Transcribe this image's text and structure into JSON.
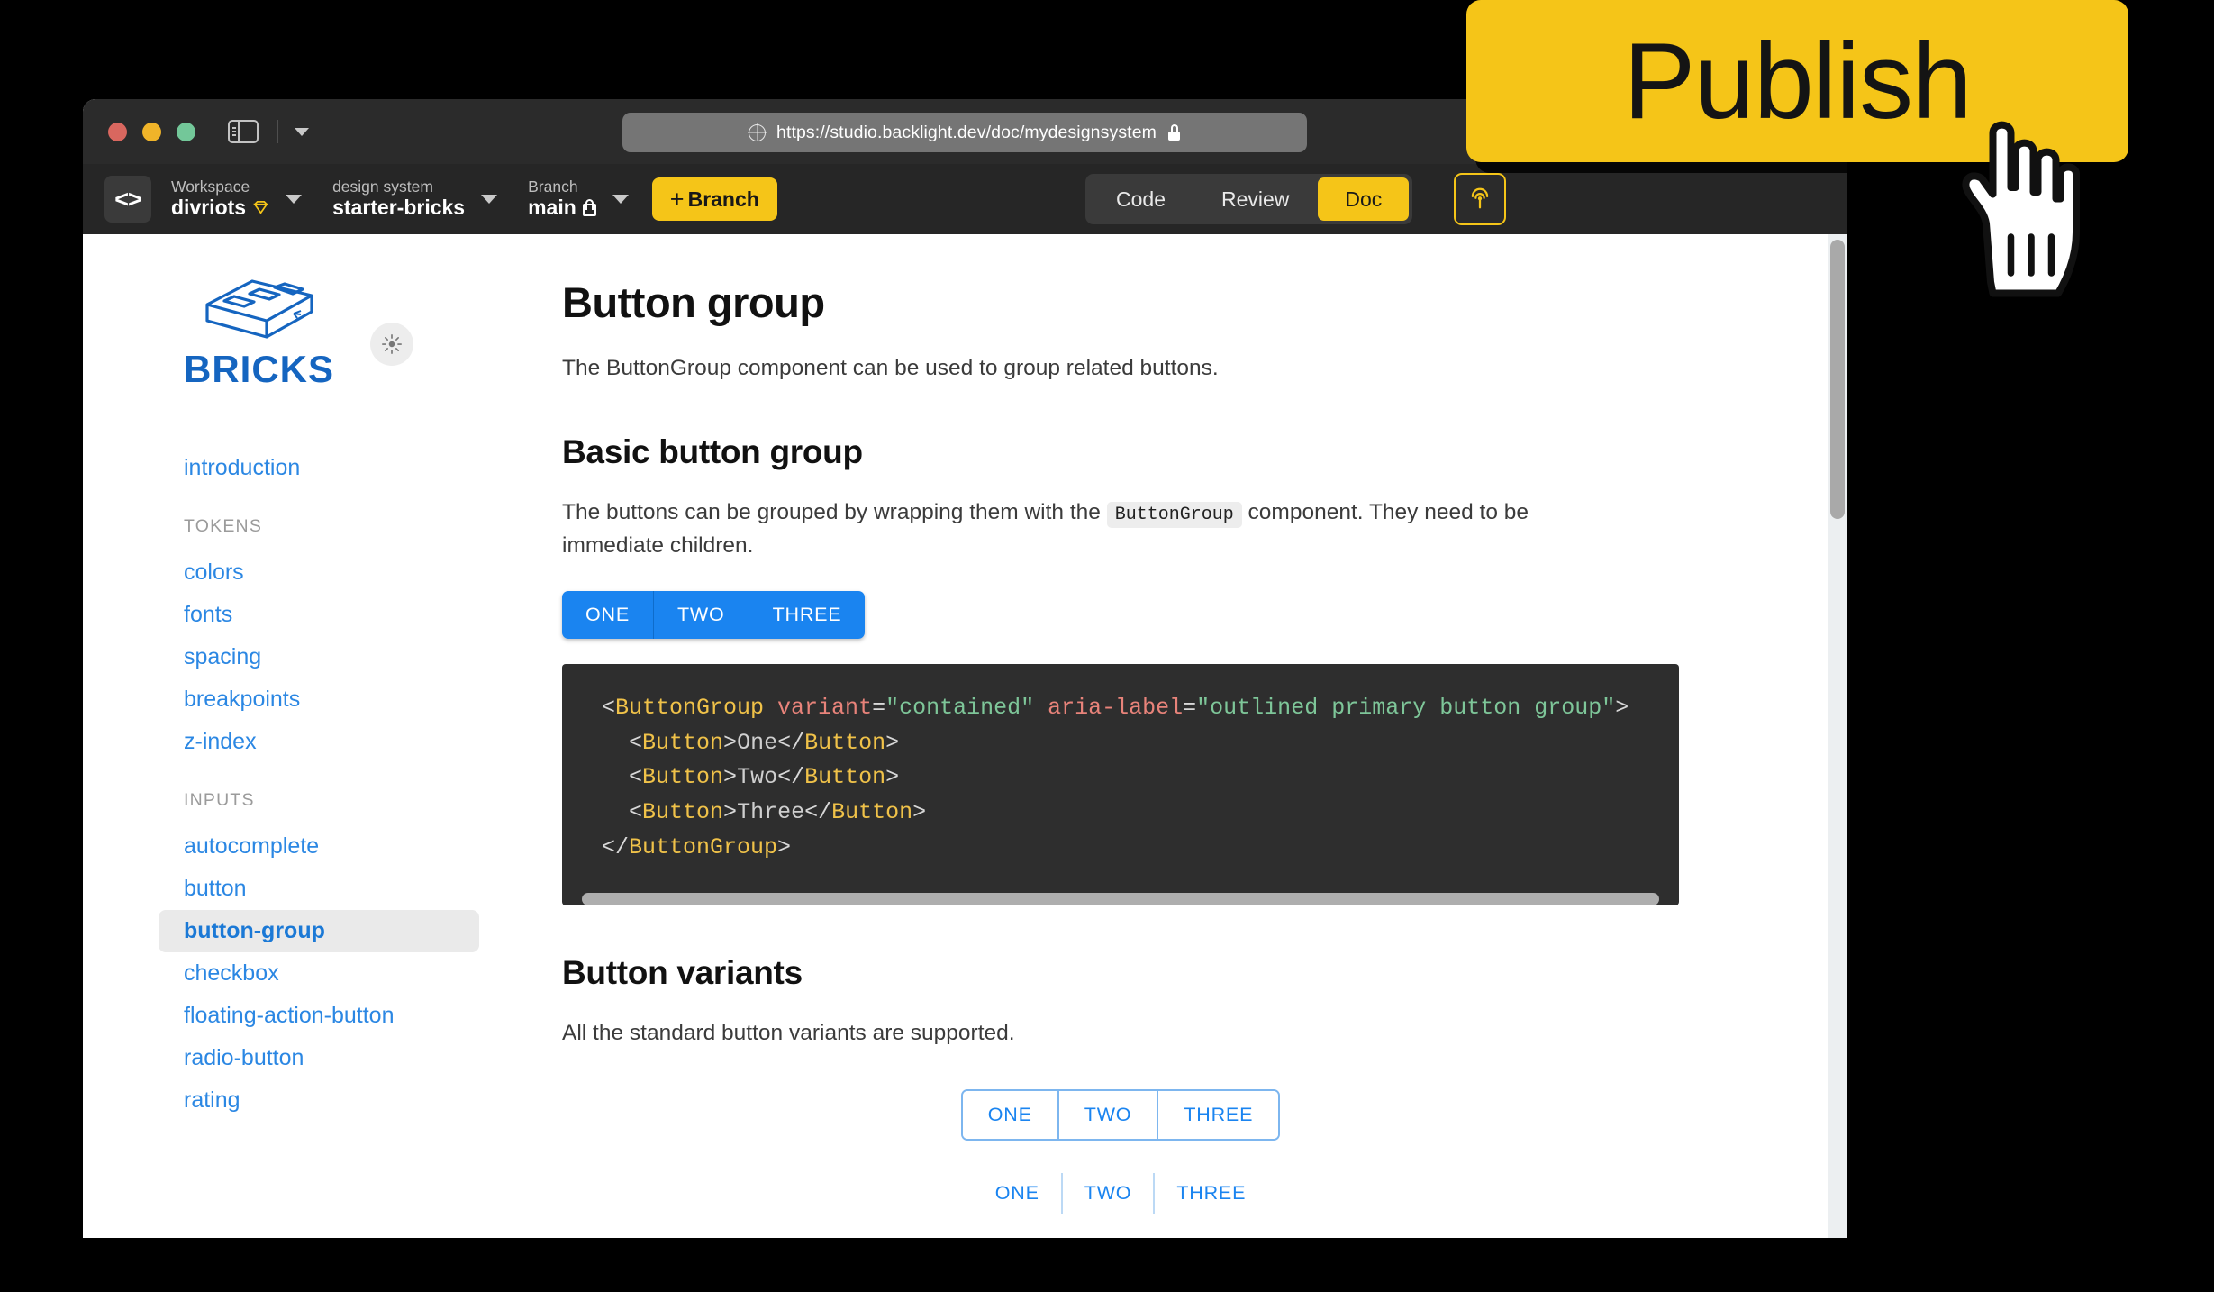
{
  "browser": {
    "window_controls": [
      "close",
      "minimize",
      "maximize"
    ],
    "sidebar_toggle_icon": "sidebar-toggle-icon",
    "tab_overflow_icon": "chevron-down-icon",
    "url": "https://studio.backlight.dev/doc/mydesignsystem",
    "url_globe_icon": "globe-icon",
    "url_lock_icon": "lock-icon",
    "url_more_icon": "more-options-icon"
  },
  "toolbar": {
    "logo_glyph": "<>",
    "workspace": {
      "label": "Workspace",
      "value": "divriots",
      "badge_icon": "gem-icon"
    },
    "design_system": {
      "label": "design system",
      "value": "starter-bricks"
    },
    "branch": {
      "label": "Branch",
      "value": "main",
      "lock_icon": "lock-icon"
    },
    "branch_button": {
      "plus": "+",
      "label": "Branch"
    },
    "tabs": [
      {
        "label": "Code",
        "active": false
      },
      {
        "label": "Review",
        "active": false
      },
      {
        "label": "Doc",
        "active": true
      }
    ],
    "publish_icon": "publish-broadcast-icon"
  },
  "sidebar": {
    "brand_name": "BRICKS",
    "brand_logo_icon": "brick-logo-icon",
    "theme_toggle_icon": "sun-theme-icon",
    "items": [
      {
        "label": "introduction",
        "type": "link",
        "active": false
      },
      {
        "label": "TOKENS",
        "type": "group"
      },
      {
        "label": "colors",
        "type": "link",
        "active": false
      },
      {
        "label": "fonts",
        "type": "link",
        "active": false
      },
      {
        "label": "spacing",
        "type": "link",
        "active": false
      },
      {
        "label": "breakpoints",
        "type": "link",
        "active": false
      },
      {
        "label": "z-index",
        "type": "link",
        "active": false
      },
      {
        "label": "INPUTS",
        "type": "group"
      },
      {
        "label": "autocomplete",
        "type": "link",
        "active": false
      },
      {
        "label": "button",
        "type": "link",
        "active": false
      },
      {
        "label": "button-group",
        "type": "link",
        "active": true
      },
      {
        "label": "checkbox",
        "type": "link",
        "active": false
      },
      {
        "label": "floating-action-button",
        "type": "link",
        "active": false
      },
      {
        "label": "radio-button",
        "type": "link",
        "active": false
      },
      {
        "label": "rating",
        "type": "link",
        "active": false
      }
    ]
  },
  "doc": {
    "title": "Button group",
    "intro": "The ButtonGroup component can be used to group related buttons.",
    "section1": {
      "heading": "Basic button group",
      "text_before": "The buttons can be grouped by wrapping them with the ",
      "inline_code": "ButtonGroup",
      "text_after": " component. They need to be immediate children.",
      "demo_buttons": [
        "ONE",
        "TWO",
        "THREE"
      ],
      "code": {
        "line1_open_punc": "<",
        "line1_tag": "ButtonGroup",
        "line1_attr1": " variant",
        "line1_eq1": "=",
        "line1_str1": "\"contained\"",
        "line1_attr2": " aria-label",
        "line1_eq2": "=",
        "line1_str2": "\"outlined primary button group\"",
        "line1_close_punc": ">",
        "child_tag": "Button",
        "child_values": [
          "One",
          "Two",
          "Three"
        ],
        "closing_tag": "ButtonGroup"
      }
    },
    "section2": {
      "heading": "Button variants",
      "text": "All the standard button variants are supported.",
      "outlined_buttons": [
        "ONE",
        "TWO",
        "THREE"
      ],
      "text_buttons": [
        "ONE",
        "TWO",
        "THREE"
      ]
    }
  },
  "overlay": {
    "publish_label": "Publish",
    "cursor_icon": "pointing-hand-cursor-icon"
  },
  "colors": {
    "brand_yellow": "#f5c518",
    "brand_blue": "#1a84f0",
    "logo_blue": "#1565c0",
    "toolbar_dark": "#262626",
    "code_bg": "#2e2e2e"
  }
}
